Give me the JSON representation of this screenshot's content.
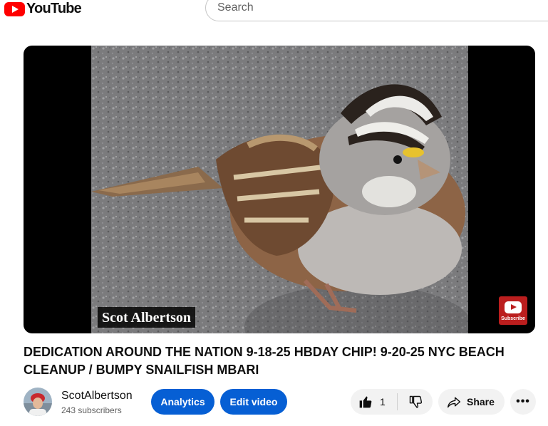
{
  "header": {
    "logo_text": "YouTube",
    "search_placeholder": "Search"
  },
  "player": {
    "watermark_text": "Scot Albertson",
    "subscribe_badge_text": "Subscribe"
  },
  "video": {
    "title": "DEDICATION AROUND THE NATION 9-18-25 HBDAY CHIP! 9-20-25 NYC BEACH CLEANUP / BUMPY SNAILFISH MBARI"
  },
  "channel": {
    "name": "ScotAlbertson",
    "subscribers": "243 subscribers"
  },
  "actions": {
    "analytics_label": "Analytics",
    "edit_label": "Edit video",
    "like_count": "1",
    "share_label": "Share",
    "more_label": "•••"
  },
  "colors": {
    "brand_red": "#ff0000",
    "primary_button": "#065fd4",
    "pill_background": "#f2f2f2"
  },
  "icons": [
    "youtube-logo-icon",
    "subscribe-logo-icon",
    "like-icon",
    "dislike-icon",
    "share-icon",
    "more-icon"
  ]
}
